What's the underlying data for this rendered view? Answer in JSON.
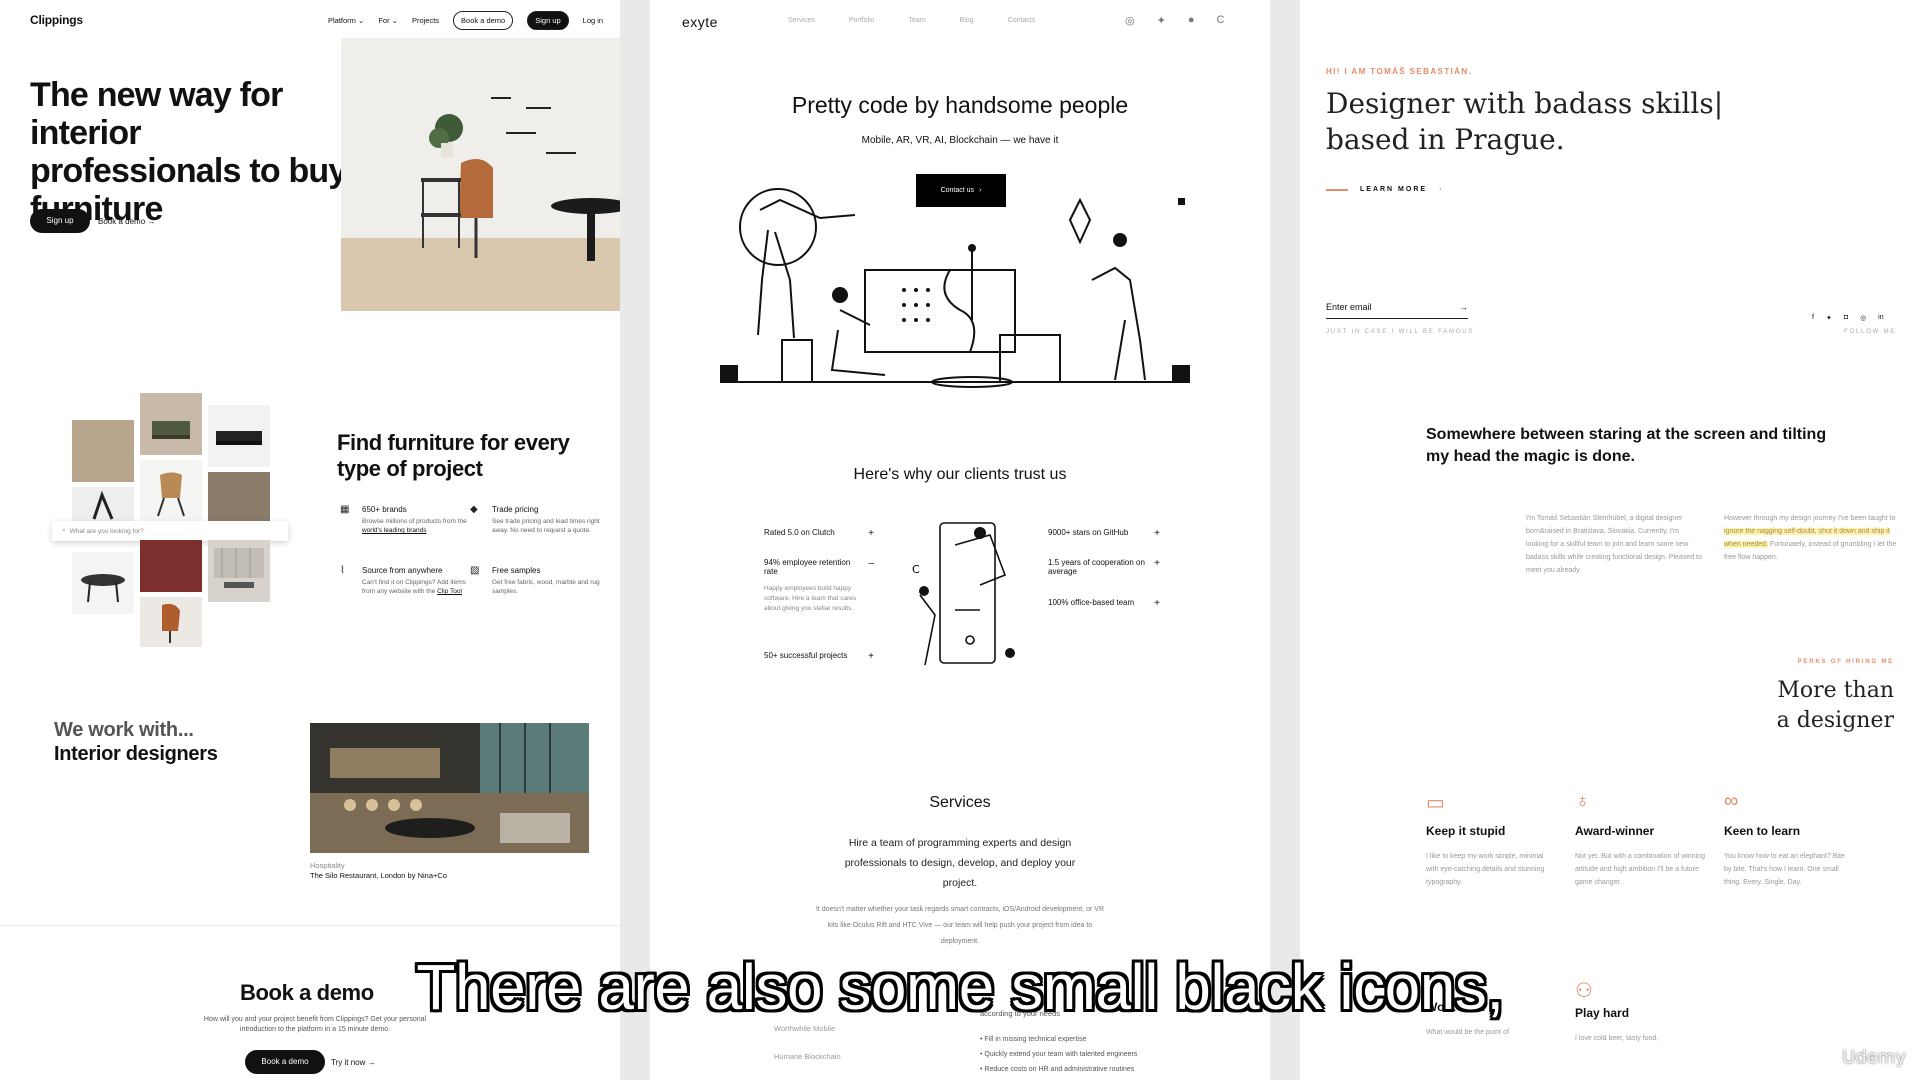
{
  "clippings": {
    "logo": "Clippings",
    "nav": [
      "Platform",
      "For",
      "Projects"
    ],
    "nav_book_demo": "Book a demo",
    "nav_signup": "Sign up",
    "nav_login": "Log in",
    "hero_title": "The new way for interior professionals to buy furniture",
    "hero_signup": "Sign up",
    "hero_book_demo": "Book a demo →",
    "search_placeholder": "What are you looking for?",
    "find_title": "Find furniture for every type of project",
    "features": [
      {
        "title": "650+ brands",
        "desc": "Browse millions of products from the ",
        "link": "world's leading brands"
      },
      {
        "title": "Trade pricing",
        "desc": "See trade pricing and lead times right away. No need to request a quote."
      },
      {
        "title": "Source from anywhere",
        "desc": "Can't find it on Clippings? Add items from any website with the ",
        "link": "Clip Tool"
      },
      {
        "title": "Free samples",
        "desc": "Get free fabric, wood, marble and rug samples."
      }
    ],
    "work_with": "We work with...",
    "work_who": "Interior designers",
    "caption_category": "Hospitality",
    "caption_title": "The Silo Restaurant, London by Nina+Co",
    "book_title": "Book a demo",
    "book_text": "How will you and your project benefit from Clippings? Get your personal introduction to the platform in a 15 minute demo.",
    "book_button": "Book a demo",
    "try_link": "Try it now →"
  },
  "exyte": {
    "logo": "exyte",
    "nav": [
      "Services",
      "Portfolio",
      "Team",
      "Blog",
      "Contacts"
    ],
    "hero_title": "Pretty code by handsome people",
    "hero_sub": "Mobile, AR, VR, AI, Blockchain — we have it",
    "contact_button": "Contact us",
    "trust_title": "Here's why our clients trust us",
    "trust_left": [
      "Rated 5.0 on Clutch",
      "94% employee retention rate",
      "50+ successful projects"
    ],
    "trust_desc": "Happy employees build happy software. Hire a team that cares about giving you stellar results.",
    "trust_right": [
      "9000+ stars on GitHub",
      "1.5 years of cooperation on average",
      "100% office-based team"
    ],
    "services_title": "Services",
    "services_text": "Hire a team of programming experts and design professionals to design, develop, and deploy your project.",
    "services_small": "It doesn't matter whether your task regards smart contracts, iOS/Android development, or VR kits like Oculus Rift and HTC Vive — our team will help push your project from idea to deployment.",
    "services_list": [
      "Worthwhile Mobile",
      "Humane Blockchain"
    ],
    "services_right_head": "according to your needs",
    "services_bullets": [
      "Fill in missing technical expertise",
      "Quickly extend your team with talented engineers",
      "Reduce costs on HR and administrative routines"
    ]
  },
  "tomas": {
    "kicker": "HI! I AM TOMÁŠ SEBASTIÁN.",
    "hero_title": "Designer with badass skills| based in Prague.",
    "learn_more": "LEARN MORE",
    "email_placeholder": "Enter email",
    "famous": "JUST IN CASE I WILL BE FAMOUS",
    "follow": "FOLLOW ME",
    "magic": "Somewhere between staring at the screen and tilting my head the magic is done.",
    "about_left": "I'm Tomáš Sebastián Steinhübel, a digital designer born&raised in Bratislava, Slovakia. Currently, I'm looking for a skillful team to join and learn some new badass skills while creating functional design. Pleased to meet you already.",
    "about_right_a": "However through my design journey I've been taught to ",
    "about_right_hl": "ignore the nagging self-doubt, shut it down and ship it when needed.",
    "about_right_b": " Fortunately, instead of grumbling I let the free flow happen.",
    "perks_kicker": "PERKS OF HIRING ME",
    "more_line1": "More than",
    "more_line2": "a designer",
    "perks": [
      {
        "title": "Keep it stupid",
        "desc": "I like to keep my work simple, minimal with eye-catching details and stunning typography."
      },
      {
        "title": "Award-winner",
        "desc": "Not yet. But with a combination of winning attitude and high ambition I'll be a future game changer."
      },
      {
        "title": "Keen to learn",
        "desc": "You know how to eat an elephant? Bite by bite. That's how I learn. One small thing. Every. Single. Day."
      },
      {
        "title": "Work hard",
        "desc": "What would be the point of"
      },
      {
        "title": "Play hard",
        "desc": "I love cold beer, tasty food,"
      }
    ]
  },
  "subtitle": "There are also some small black icons,",
  "watermark": "Udemy",
  "colors": {
    "accent": "#e58c6a",
    "dark": "#111111",
    "highlight": "#fdf2b0"
  }
}
